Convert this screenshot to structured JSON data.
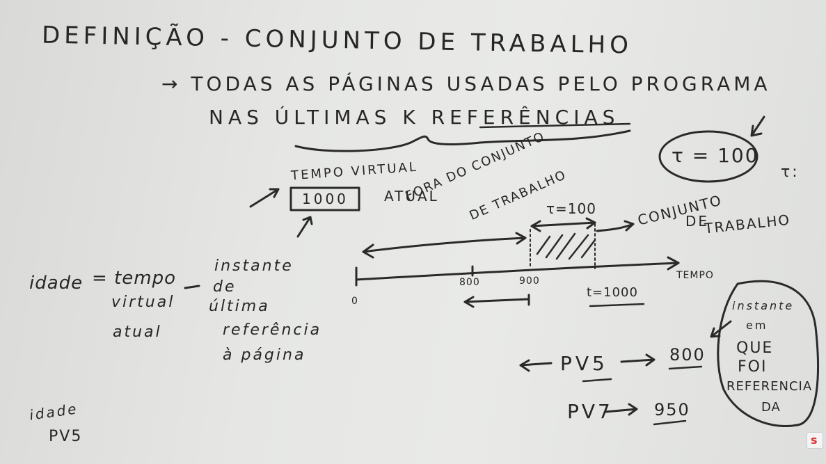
{
  "board": {
    "title": "DEFINIÇÃO - CONJUNTO DE TRABALHO",
    "definition_line1": "→ TODAS AS PÁGINAS USADAS PELO PROGRAMA",
    "definition_line2": "NAS ÚLTIMAS K REFERÊNCIAS",
    "tau_circle": "τ = 100",
    "tau_colon": "τ:",
    "virtual_time_label": "TEMPO VIRTUAL",
    "virtual_time_value": "1000",
    "virtual_time_current": "ATUAL",
    "outside_set_label_1": "FORA DO CONJUNTO",
    "outside_set_label_2": "DE TRABALHO",
    "tau_window": "τ=100",
    "working_set_label_1": "CONJUNTO",
    "working_set_label_2": "DE",
    "working_set_label_3": "TRABALHO",
    "axis_label": "TEMPO",
    "tick_0": "0",
    "tick_800": "800",
    "tick_900": "900",
    "tick_t": "t=1000",
    "age_def_1": "idade",
    "age_def_eq": "= tempo",
    "age_def_2": "virtual",
    "age_def_3": "atual",
    "age_def_minus": "-",
    "age_def_4": "instante",
    "age_def_5": "de",
    "age_def_6": "última",
    "age_def_7": "referência",
    "age_def_8": "à página",
    "pv5_label": "PV5",
    "pv5_value": "800",
    "pv7_label": "PV7",
    "pv7_value": "950",
    "instant_note_1": "instante",
    "instant_note_2": "em",
    "instant_note_3": "QUE",
    "instant_note_4": "FOI",
    "instant_note_5": "REFERENCIA",
    "instant_note_6": "DA",
    "bottom_left_1": "idade",
    "bottom_left_2": "PV5"
  }
}
